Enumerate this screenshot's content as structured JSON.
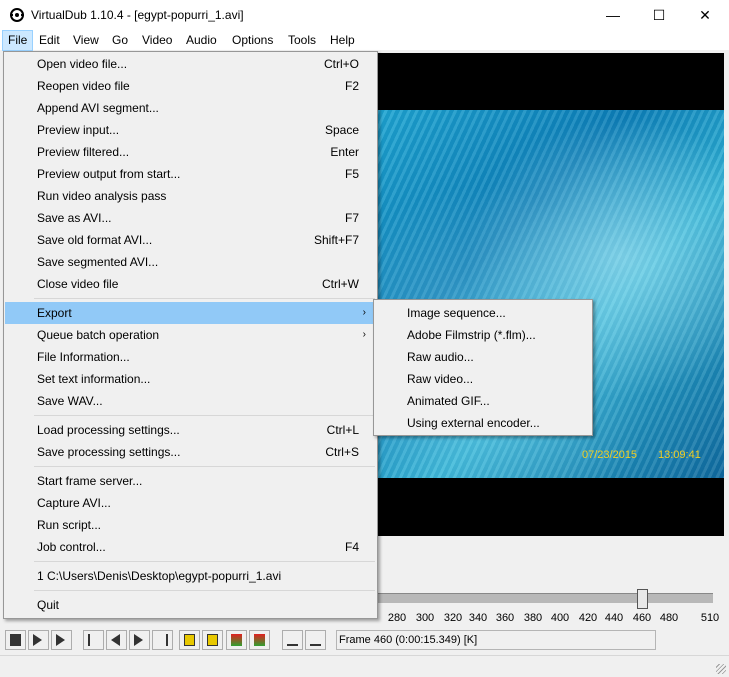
{
  "window": {
    "title": "VirtualDub 1.10.4 - [egypt-popurri_1.avi]",
    "minimize": "—",
    "maximize": "☐",
    "close": "✕"
  },
  "menubar": [
    "File",
    "Edit",
    "View",
    "Go",
    "Video",
    "Audio",
    "Options",
    "Tools",
    "Help"
  ],
  "file_menu": {
    "items": [
      {
        "label": "Open video file...",
        "shortcut": "Ctrl+O"
      },
      {
        "label": "Reopen video file",
        "shortcut": "F2"
      },
      {
        "label": "Append AVI segment...",
        "shortcut": ""
      },
      {
        "label": "Preview input...",
        "shortcut": "Space"
      },
      {
        "label": "Preview filtered...",
        "shortcut": "Enter"
      },
      {
        "label": "Preview output from start...",
        "shortcut": "F5"
      },
      {
        "label": "Run video analysis pass",
        "shortcut": ""
      },
      {
        "label": "Save as AVI...",
        "shortcut": "F7"
      },
      {
        "label": "Save old format AVI...",
        "shortcut": "Shift+F7"
      },
      {
        "label": "Save segmented AVI...",
        "shortcut": ""
      },
      {
        "label": "Close video file",
        "shortcut": "Ctrl+W"
      },
      {
        "label": "Export",
        "shortcut": ""
      },
      {
        "label": "Queue batch operation",
        "shortcut": ""
      },
      {
        "label": "File Information...",
        "shortcut": ""
      },
      {
        "label": "Set text information...",
        "shortcut": ""
      },
      {
        "label": "Save WAV...",
        "shortcut": ""
      },
      {
        "label": "Load processing settings...",
        "shortcut": "Ctrl+L"
      },
      {
        "label": "Save processing settings...",
        "shortcut": "Ctrl+S"
      },
      {
        "label": "Start frame server...",
        "shortcut": ""
      },
      {
        "label": "Capture AVI...",
        "shortcut": ""
      },
      {
        "label": "Run script...",
        "shortcut": ""
      },
      {
        "label": "Job control...",
        "shortcut": "F4"
      },
      {
        "label": "1 C:\\Users\\Denis\\Desktop\\egypt-popurri_1.avi",
        "shortcut": ""
      },
      {
        "label": "Quit",
        "shortcut": ""
      }
    ]
  },
  "export_submenu": [
    "Image sequence...",
    "Adobe Filmstrip (*.flm)...",
    "Raw audio...",
    "Raw video...",
    "Animated GIF...",
    "Using external encoder..."
  ],
  "video_osd": {
    "date": "07/23/2015",
    "time": "13:09:41"
  },
  "timeline": {
    "position_frame": 460,
    "ticks": [
      "280",
      "300",
      "320",
      "340",
      "360",
      "380",
      "400",
      "420",
      "440",
      "460",
      "480",
      "510"
    ]
  },
  "frame_status": "Frame 460 (0:00:15.349) [K]",
  "toolbar_icons": [
    "stop-icon",
    "play-input-icon",
    "play-output-icon",
    "go-start-icon",
    "prev-frame-icon",
    "next-frame-icon",
    "go-end-icon",
    "prev-keyframe-icon",
    "next-keyframe-icon",
    "scene-back-icon",
    "scene-forward-icon",
    "mark-in-icon",
    "mark-out-icon"
  ]
}
